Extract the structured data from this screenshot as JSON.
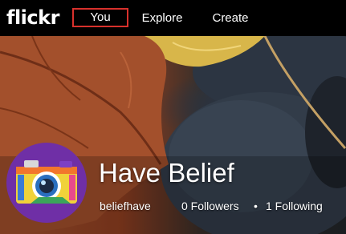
{
  "app": {
    "logo": "flickr"
  },
  "nav": {
    "items": [
      {
        "label": "You",
        "active": true
      },
      {
        "label": "Explore"
      },
      {
        "label": "Create"
      }
    ],
    "highlight_color": "#d8312c"
  },
  "profile": {
    "display_name": "Have Belief",
    "username": "beliefhave",
    "followers": "0 Followers",
    "separator": "•",
    "following": "1 Following",
    "avatar_icon": "camera-illustration-icon",
    "avatar_bg": "#6f2fa6"
  },
  "cover": {
    "description_icon": "cover-photo"
  }
}
